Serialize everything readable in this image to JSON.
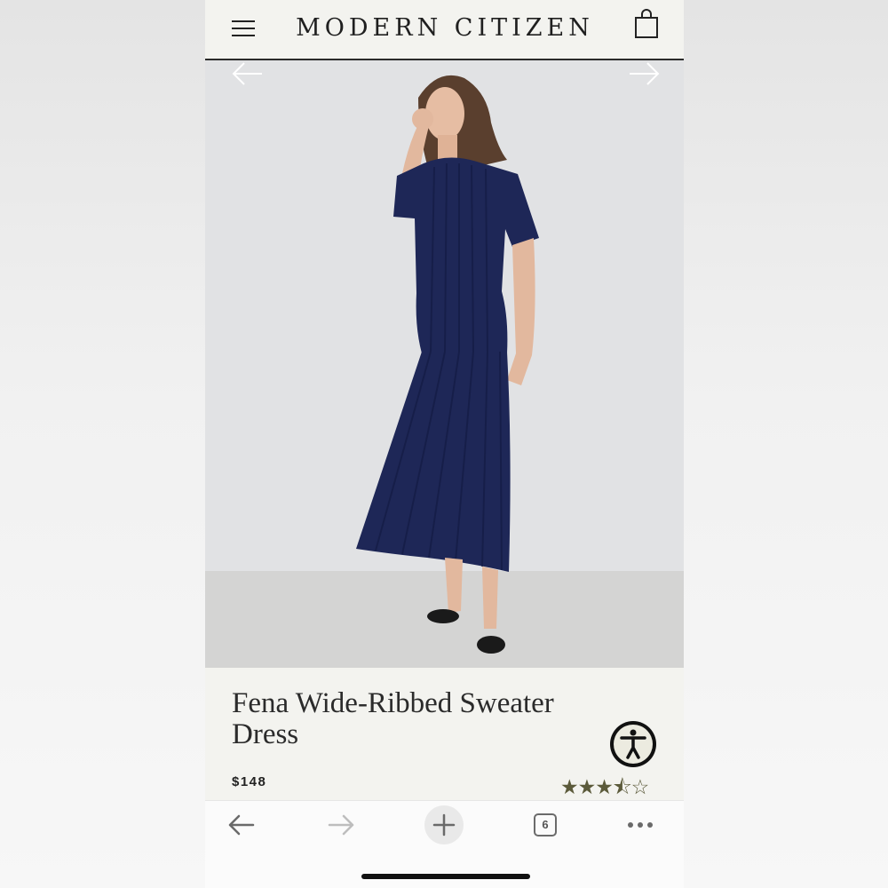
{
  "header": {
    "brand": "MODERN CITIZEN",
    "menu_icon": "hamburger-menu-icon",
    "bag_icon": "shopping-bag-icon"
  },
  "gallery": {
    "prev_icon": "arrow-left-icon",
    "next_icon": "arrow-right-icon"
  },
  "product": {
    "title": "Fena Wide-Ribbed Sweater Dress",
    "price": "$148",
    "rating": 3.5,
    "rating_max": 5,
    "stars": [
      "★",
      "★",
      "★",
      "⯪",
      "☆"
    ],
    "star_color": "#5b5a3a"
  },
  "accessibility": {
    "icon": "accessibility-person-icon"
  },
  "browser": {
    "back_icon": "back-arrow-icon",
    "forward_icon": "forward-arrow-icon",
    "new_tab_icon": "plus-icon",
    "tab_count": "6",
    "more_icon": "more-dots-icon"
  },
  "colors": {
    "dress": "#1e2757",
    "background": "#f3f3ef",
    "header_rule": "#2a2a2a"
  }
}
